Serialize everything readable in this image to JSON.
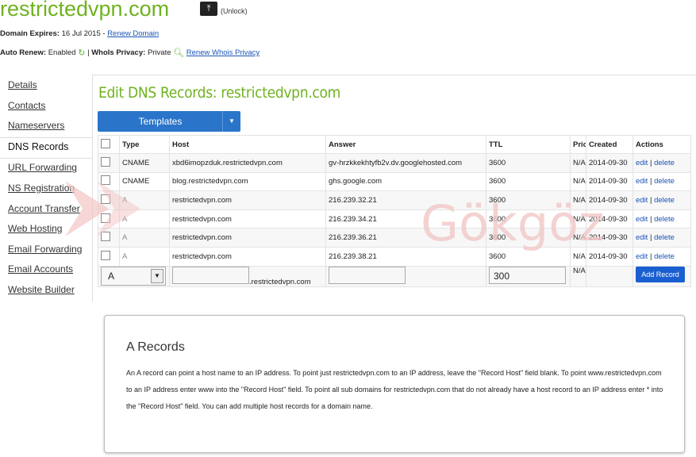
{
  "header": {
    "domain": "restrictedvpn.com",
    "unlock_label": "(Unlock)",
    "expires_label": "Domain Expires:",
    "expires_value": "16 Jul 2015",
    "renew_domain": "Renew Domain",
    "auto_renew_label": "Auto Renew:",
    "auto_renew_value": "Enabled",
    "whois_label": "WhoIs Privacy:",
    "whois_value": "Private",
    "renew_whois": "Renew Whois Privacy"
  },
  "sidebar": {
    "items": [
      {
        "label": "Details"
      },
      {
        "label": "Contacts"
      },
      {
        "label": "Nameservers"
      },
      {
        "label": "DNS Records"
      },
      {
        "label": "URL Forwarding"
      },
      {
        "label": "NS Registration"
      },
      {
        "label": "Account Transfer"
      },
      {
        "label": "Web Hosting"
      },
      {
        "label": "Email Forwarding"
      },
      {
        "label": "Email Accounts"
      },
      {
        "label": "Website Builder"
      }
    ]
  },
  "main": {
    "heading": "Edit DNS Records: restrictedvpn.com",
    "templates_label": "Templates",
    "columns": [
      "Type",
      "Host",
      "Answer",
      "TTL",
      "Prio",
      "Created",
      "Actions"
    ],
    "rows": [
      {
        "type": "CNAME",
        "host": "xbd6imopzduk.restrictedvpn.com",
        "answer": "gv-hrzkkekhtyfb2v.dv.googlehosted.com",
        "ttl": "3600",
        "prio": "N/A",
        "created": "2014-09-30"
      },
      {
        "type": "CNAME",
        "host": "blog.restrictedvpn.com",
        "answer": "ghs.google.com",
        "ttl": "3600",
        "prio": "N/A",
        "created": "2014-09-30"
      },
      {
        "type": "A",
        "host": "restrictedvpn.com",
        "answer": "216.239.32.21",
        "ttl": "3600",
        "prio": "N/A",
        "created": "2014-09-30"
      },
      {
        "type": "A",
        "host": "restrictedvpn.com",
        "answer": "216.239.34.21",
        "ttl": "3600",
        "prio": "N/A",
        "created": "2014-09-30"
      },
      {
        "type": "A",
        "host": "restrictedvpn.com",
        "answer": "216.239.36.21",
        "ttl": "3600",
        "prio": "N/A",
        "created": "2014-09-30"
      },
      {
        "type": "A",
        "host": "restrictedvpn.com",
        "answer": "216.239.38.21",
        "ttl": "3600",
        "prio": "N/A",
        "created": "2014-09-30"
      }
    ],
    "edit_label": "edit",
    "delete_label": "delete",
    "separator": "|",
    "new_record": {
      "type_value": "A",
      "host_suffix": ".restrictedvpn.com",
      "ttl_value": "300",
      "prio": "N/A",
      "add_label": "Add Record"
    }
  },
  "info": {
    "title": "A Records",
    "text": "An A record can point a host name to an IP address. To point just restrictedvpn.com to an IP address, leave the \"Record Host\" field blank. To point www.restrictedvpn.com to an IP address enter www into the \"Record Host\" field. To point all sub domains for restrictedvpn.com that do not already have a host record to an IP address enter * into the \"Record Host\" field. You can add multiple host records for a domain name."
  },
  "watermark": {
    "text": "Gökgöz"
  },
  "colors": {
    "accent_green": "#6fb21f",
    "link_blue": "#1a55b8",
    "button_blue": "#2a75c9"
  }
}
